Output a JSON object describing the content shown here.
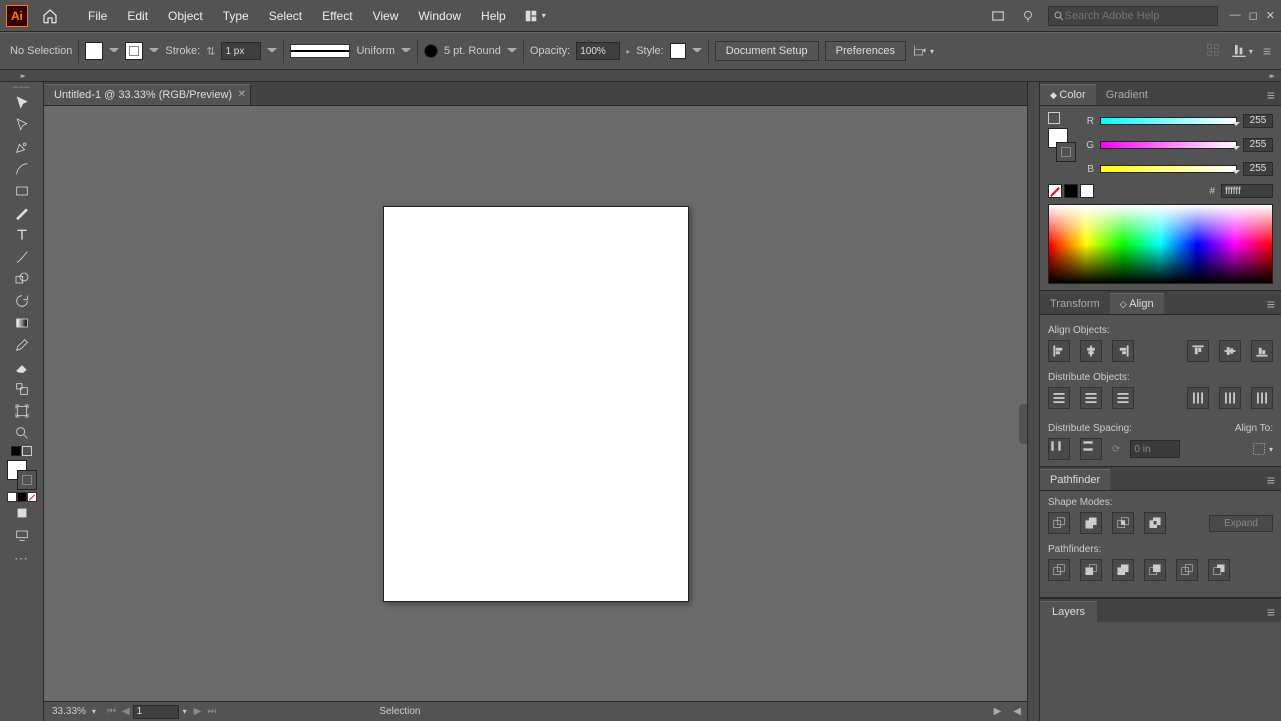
{
  "menu": {
    "items": [
      "File",
      "Edit",
      "Object",
      "Type",
      "Select",
      "Effect",
      "View",
      "Window",
      "Help"
    ],
    "search_placeholder": "Search Adobe Help"
  },
  "control": {
    "selection_label": "No Selection",
    "stroke_label": "Stroke:",
    "stroke_value": "1 px",
    "profile_label": "Uniform",
    "brush_label": "5 pt. Round",
    "opacity_label": "Opacity:",
    "opacity_value": "100%",
    "style_label": "Style:",
    "doc_setup": "Document Setup",
    "preferences": "Preferences"
  },
  "document": {
    "tab_title": "Untitled-1 @ 33.33% (RGB/Preview)"
  },
  "status": {
    "zoom": "33.33%",
    "page": "1",
    "tool": "Selection"
  },
  "panels": {
    "color": {
      "tab1": "Color",
      "tab2": "Gradient",
      "r": "255",
      "g": "255",
      "b": "255",
      "hex_label": "#",
      "hex": "ffffff"
    },
    "align": {
      "tab1": "Transform",
      "tab2": "Align",
      "sec1": "Align Objects:",
      "sec2": "Distribute Objects:",
      "sec3": "Distribute Spacing:",
      "alignto": "Align To:",
      "spacing_value": "0 in"
    },
    "pathfinder": {
      "tab": "Pathfinder",
      "sec1": "Shape Modes:",
      "sec2": "Pathfinders:",
      "expand": "Expand"
    },
    "layers": {
      "tab": "Layers"
    }
  }
}
